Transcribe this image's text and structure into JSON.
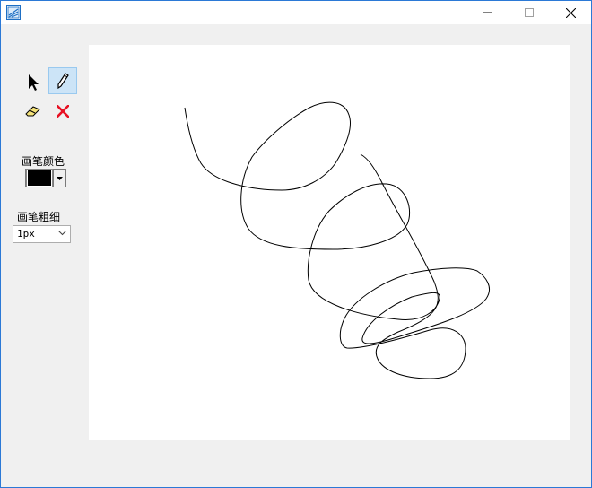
{
  "window": {
    "title": ""
  },
  "tools": {
    "select": {
      "icon": "arrow-cursor-icon"
    },
    "pen": {
      "icon": "pencil-icon",
      "active": true
    },
    "eraser": {
      "icon": "eraser-icon"
    },
    "clear": {
      "icon": "red-x-icon",
      "color": "#e81123"
    }
  },
  "pen_color": {
    "label": "画笔颜色",
    "value": "#000000"
  },
  "pen_width": {
    "label": "画笔粗细",
    "selected": "1px"
  },
  "colors": {
    "accent_border": "#2b79d6",
    "active_tool_bg": "#cce4f7",
    "panel_bg": "#f0f0f0"
  }
}
